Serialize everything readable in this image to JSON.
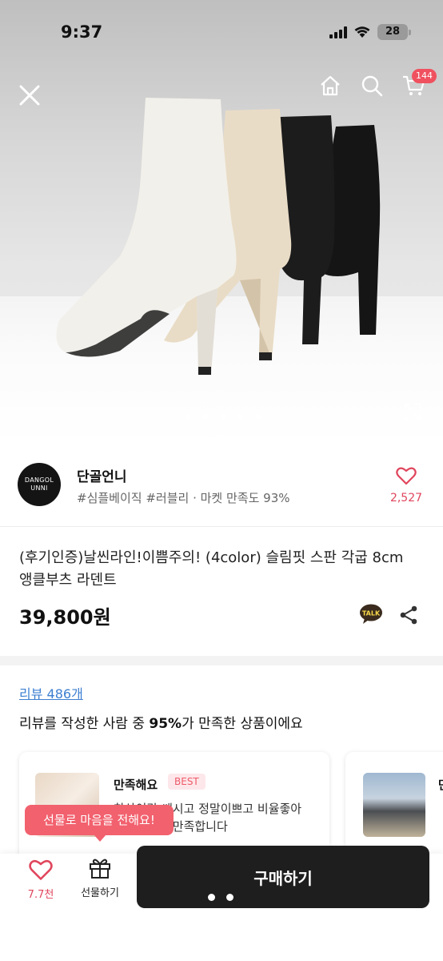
{
  "status_bar": {
    "time": "9:37",
    "battery": "28"
  },
  "hero": {
    "cart_badge": "144",
    "image_count": 5,
    "active_image": 1
  },
  "shop": {
    "logo_line1": "DANGOL",
    "logo_line2": "UNNI",
    "name": "단골언니",
    "tags": "#심플베이직 #러블리 · 마켓 만족도 93%",
    "likes": "2,527"
  },
  "product": {
    "title": "(후기인증)날씬라인!이쁨주의! (4color) 슬림핏 스판 각굽 8cm 앵클부츠 라덴트",
    "price": "39,800원",
    "talk_label": "TALK"
  },
  "reviews": {
    "count_label": "리뷰 486개",
    "summary_prefix": "리뷰를 작성한 사람 중 ",
    "summary_percent": "95%",
    "summary_suffix": "가 만족한 상품이에요",
    "cards": [
      {
        "rating_label": "만족해요",
        "badge": "BEST",
        "text": "착샷이랑 쌔시고 정말이쁘고 비율좋아 보이고 완전만족합니다"
      },
      {
        "rating_label": "만",
        "text": ""
      }
    ]
  },
  "gift_tooltip": "선물로 마음을 전해요!",
  "bottom_bar": {
    "like_count": "7.7천",
    "gift_label": "선물하기",
    "buy_label": "구매하기"
  },
  "colors": {
    "accent_pink": "#f2616e",
    "like_red": "#e0455c",
    "link_blue": "#3d7fd1",
    "buy_button": "#1e1e1e"
  }
}
